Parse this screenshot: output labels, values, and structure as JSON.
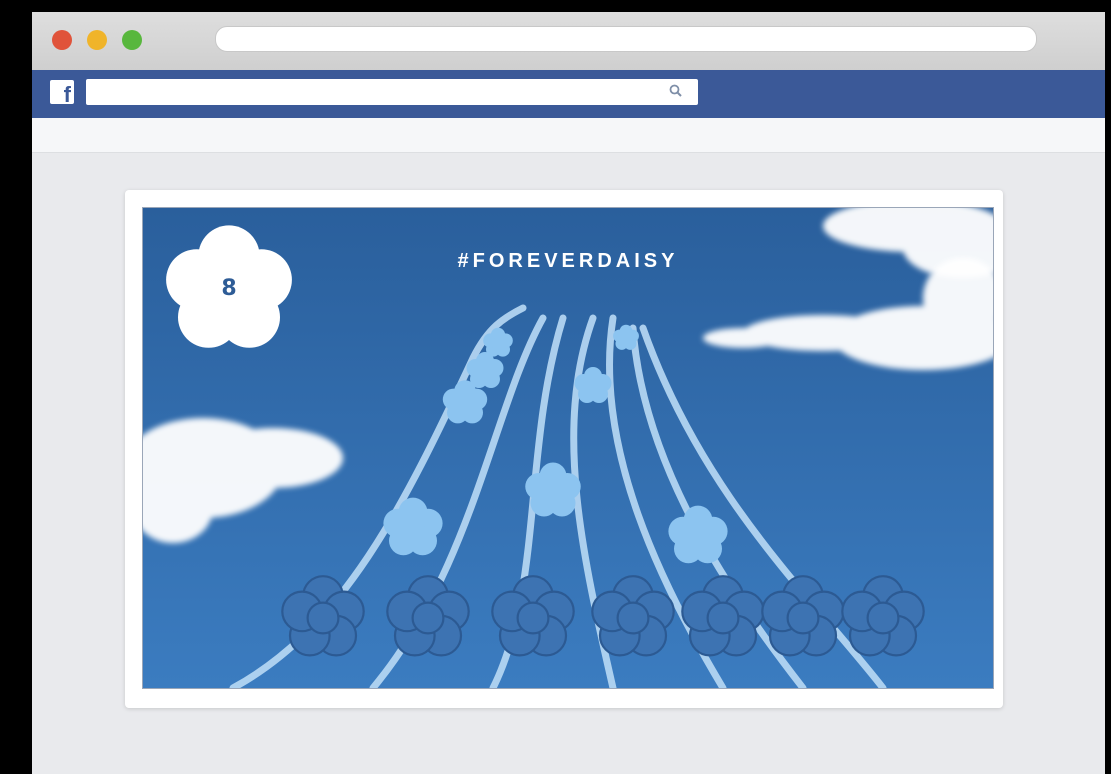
{
  "browser": {
    "url": "",
    "traffic_lights": [
      "close",
      "minimize",
      "zoom"
    ]
  },
  "facebook": {
    "logo_letter": "f",
    "search_placeholder": "",
    "search_icon": "magnifier-icon"
  },
  "cover_post": {
    "hashtag": "#FOREVERDAISY",
    "badge_number": "8",
    "badge_icon": "daisy-icon",
    "colors": {
      "sky": "#2f6aa8",
      "flower_light": "#8cc4f0",
      "flower_dark": "#3d73b2",
      "accent": "#3b5998"
    }
  }
}
